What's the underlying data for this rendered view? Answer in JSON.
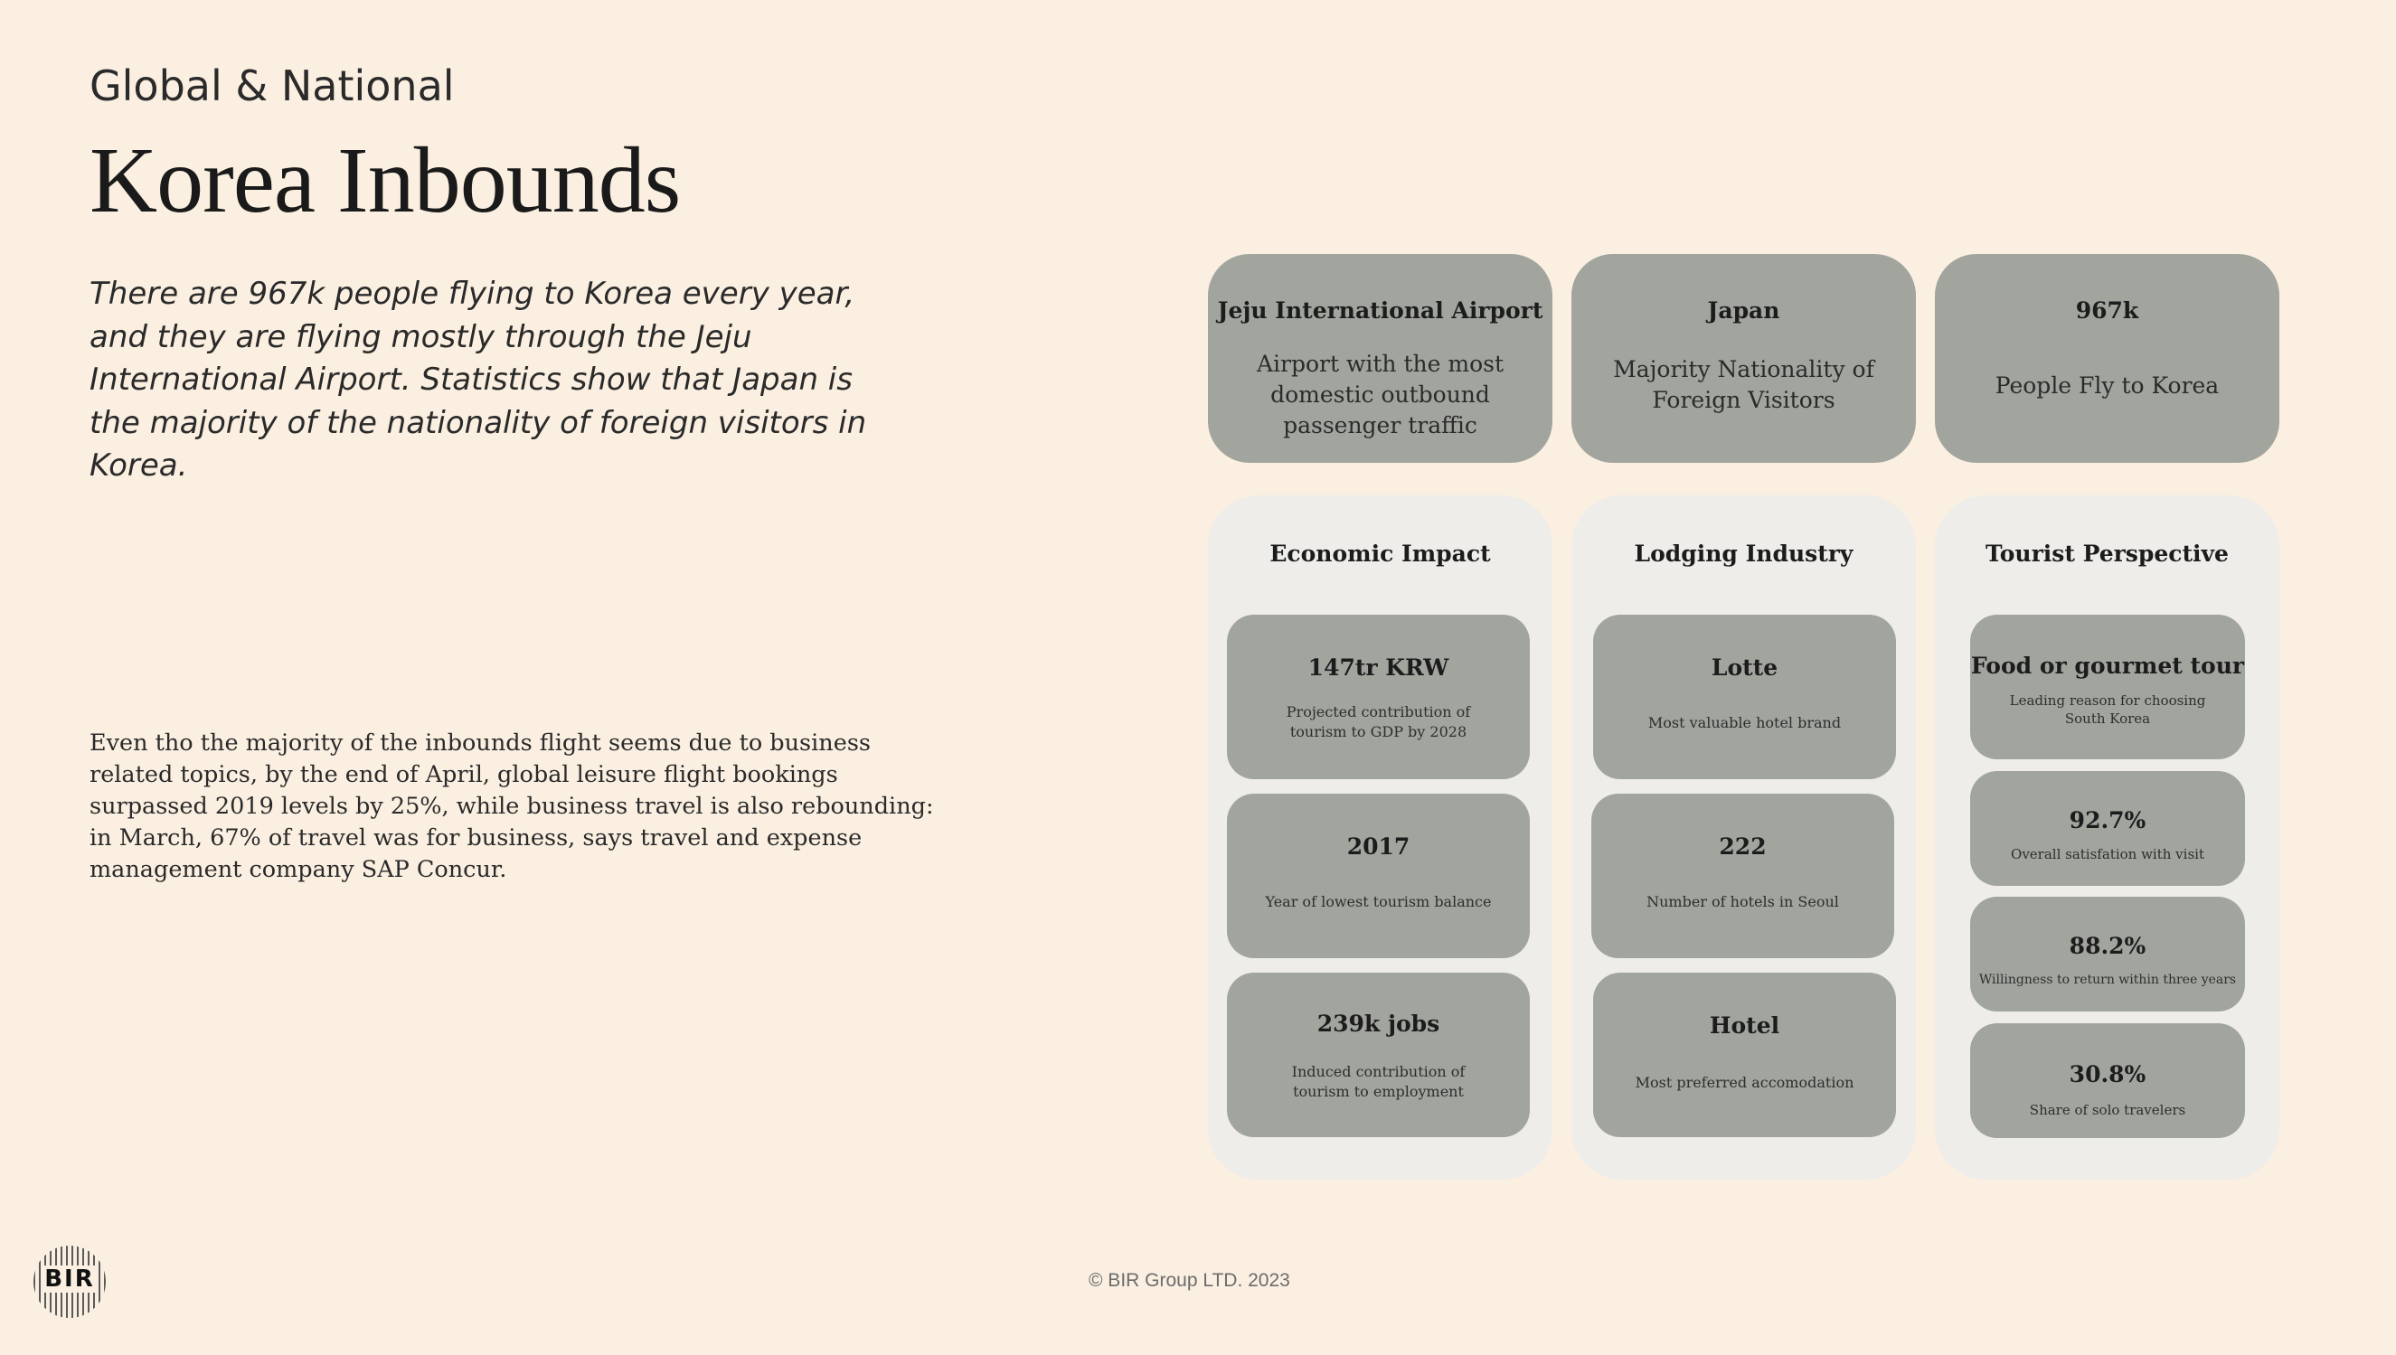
{
  "header": {
    "eyebrow": "Global & National",
    "title": "Korea Inbounds"
  },
  "lead": "There are 967k people flying to Korea every year, and they are flying mostly through the Jeju International Airport. Statistics show that Japan is the majority of the nationality of foreign visitors in Korea.",
  "body": "Even tho the majority of the inbounds flight seems due to business related topics, by the end of April, global leisure flight bookings surpassed 2019 levels by 25%, while business travel is also rebounding: in March, 67% of travel was for business, says travel and expense management company SAP Concur.",
  "top_cards": [
    {
      "title": "Jeju International Airport",
      "desc": "Airport with the most domestic outbound passenger traffic"
    },
    {
      "title": "Japan",
      "desc": "Majority Nationality of Foreign Visitors"
    },
    {
      "title": "967k",
      "desc": "People Fly to Korea"
    }
  ],
  "columns": [
    {
      "title": "Economic Impact",
      "stats": [
        {
          "value": "147tr KRW",
          "label": "Projected contribution of tourism to GDP by 2028"
        },
        {
          "value": "2017",
          "label": "Year of lowest tourism balance"
        },
        {
          "value": "239k jobs",
          "label": "Induced contribution of tourism to employment"
        }
      ]
    },
    {
      "title": "Lodging Industry",
      "stats": [
        {
          "value": "Lotte",
          "label": "Most valuable hotel brand"
        },
        {
          "value": "222",
          "label": "Number of hotels in Seoul"
        },
        {
          "value": "Hotel",
          "label": "Most preferred accomodation"
        }
      ]
    },
    {
      "title": "Tourist Perspective",
      "stats": [
        {
          "value": "Food or gourmet tour",
          "label": "Leading reason for choosing South Korea"
        },
        {
          "value": "92.7%",
          "label": "Overall satisfation with visit"
        },
        {
          "value": "88.2%",
          "label": "Willingness to return within three years"
        },
        {
          "value": "30.8%",
          "label": "Share of solo travelers"
        }
      ]
    }
  ],
  "footer": {
    "copyright": "© BIR Group LTD. 2023",
    "logo_text": "BIR"
  }
}
